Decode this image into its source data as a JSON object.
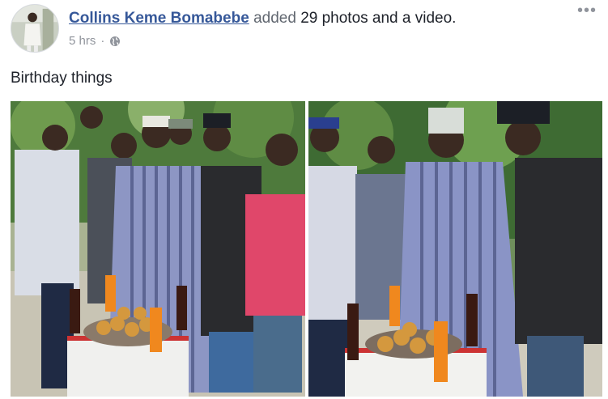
{
  "post": {
    "author": "Collins Keme Bomabebe",
    "action_prefix": "added",
    "count_text": "29 photos and a video.",
    "time": "5 hrs",
    "separator": "·",
    "privacy_icon": "globe-icon",
    "more_icon": "ellipsis-icon",
    "more_glyph": "•••",
    "caption": "Birthday things"
  },
  "photos": [
    {
      "subject": "birthday-group-photo"
    },
    {
      "subject": "birthday-group-photo-2"
    }
  ],
  "colors": {
    "link": "#365899",
    "muted": "#90949c",
    "text": "#1d2129"
  }
}
